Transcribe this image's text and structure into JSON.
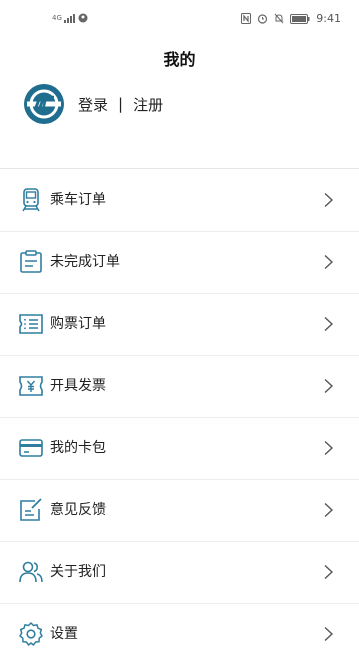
{
  "status_bar": {
    "network": "4G",
    "time": "9:41"
  },
  "page": {
    "title": "我的"
  },
  "profile": {
    "login_label": "登录",
    "separator": "|",
    "register_label": "注册"
  },
  "menu": {
    "items": [
      {
        "label": "乘车订单",
        "icon": "train-icon"
      },
      {
        "label": "未完成订单",
        "icon": "clipboard-icon"
      },
      {
        "label": "购票订单",
        "icon": "ticket-list-icon"
      },
      {
        "label": "开具发票",
        "icon": "invoice-yen-icon"
      },
      {
        "label": "我的卡包",
        "icon": "card-wallet-icon"
      },
      {
        "label": "意见反馈",
        "icon": "feedback-edit-icon"
      },
      {
        "label": "关于我们",
        "icon": "users-icon"
      },
      {
        "label": "设置",
        "icon": "gear-icon"
      }
    ]
  },
  "colors": {
    "accent": "#2f7ea0",
    "logo": "#1f6e90"
  }
}
